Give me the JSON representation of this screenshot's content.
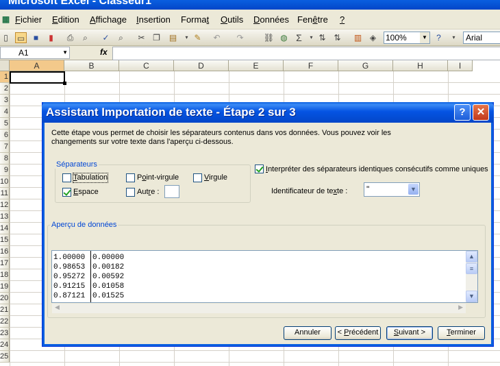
{
  "window": {
    "title": "Microsoft Excel - Classeur1"
  },
  "menu": [
    {
      "pre": "",
      "u": "F",
      "post": "ichier"
    },
    {
      "pre": "",
      "u": "E",
      "post": "dition"
    },
    {
      "pre": "",
      "u": "A",
      "post": "ffichage"
    },
    {
      "pre": "",
      "u": "I",
      "post": "nsertion"
    },
    {
      "pre": "Forma",
      "u": "t",
      "post": ""
    },
    {
      "pre": "",
      "u": "O",
      "post": "utils"
    },
    {
      "pre": "",
      "u": "D",
      "post": "onnées"
    },
    {
      "pre": "Fen",
      "u": "ê",
      "post": "tre"
    },
    {
      "pre": "",
      "u": "?",
      "post": ""
    }
  ],
  "toolbar": {
    "zoom": "100%",
    "font": "Arial",
    "sum_symbol": "Σ"
  },
  "formula_bar": {
    "cell_ref": "A1",
    "fx": "fx"
  },
  "columns": [
    "A",
    "B",
    "C",
    "D",
    "E",
    "F",
    "G",
    "H",
    "I"
  ],
  "rows": [
    "1",
    "2",
    "3",
    "4",
    "5",
    "6",
    "7",
    "8",
    "9",
    "10",
    "11",
    "12",
    "13",
    "14",
    "15",
    "16",
    "17",
    "18",
    "19",
    "20",
    "21",
    "22",
    "23",
    "24",
    "25"
  ],
  "dialog": {
    "title": "Assistant Importation de texte - Étape 2 sur 3",
    "help": "?",
    "close": "✕",
    "description": "Cette étape vous permet de choisir les séparateurs contenus dans vos données. Vous pouvez voir les changements sur votre texte dans l'aperçu ci-dessous.",
    "separators_legend": "Séparateurs",
    "tab": {
      "pre": "",
      "u": "T",
      "post": "abulation",
      "checked": false
    },
    "semicolon": {
      "pre": "P",
      "u": "o",
      "post": "int-virgule",
      "checked": false
    },
    "comma": {
      "pre": "",
      "u": "V",
      "post": "irgule",
      "checked": false
    },
    "space": {
      "pre": "",
      "u": "E",
      "post": "space",
      "checked": true
    },
    "other": {
      "pre": "Aut",
      "u": "r",
      "post": "e :",
      "checked": false,
      "value": ""
    },
    "consecutive": {
      "pre": "",
      "u": "I",
      "post": "nterpréter des séparateurs identiques consécutifs comme uniques",
      "checked": true
    },
    "text_qualifier_label": {
      "pre": "Identificateur de te",
      "u": "x",
      "post": "te :"
    },
    "text_qualifier_value": "\"",
    "preview_legend": {
      "pre": "Ap",
      "u": "e",
      "post": "rçu de données"
    },
    "preview_rows": [
      [
        "1.00000",
        "0.00000"
      ],
      [
        "0.98653",
        "0.00182"
      ],
      [
        "0.95272",
        "0.00592"
      ],
      [
        "0.91215",
        "0.01058"
      ],
      [
        "0.87121",
        "0.01525"
      ]
    ],
    "buttons": {
      "cancel": {
        "pre": "Annuler",
        "u": "",
        "post": ""
      },
      "back": {
        "pre": "< ",
        "u": "P",
        "post": "récédent"
      },
      "next": {
        "pre": "",
        "u": "S",
        "post": "uivant >"
      },
      "finish": {
        "pre": "",
        "u": "T",
        "post": "erminer"
      }
    }
  }
}
